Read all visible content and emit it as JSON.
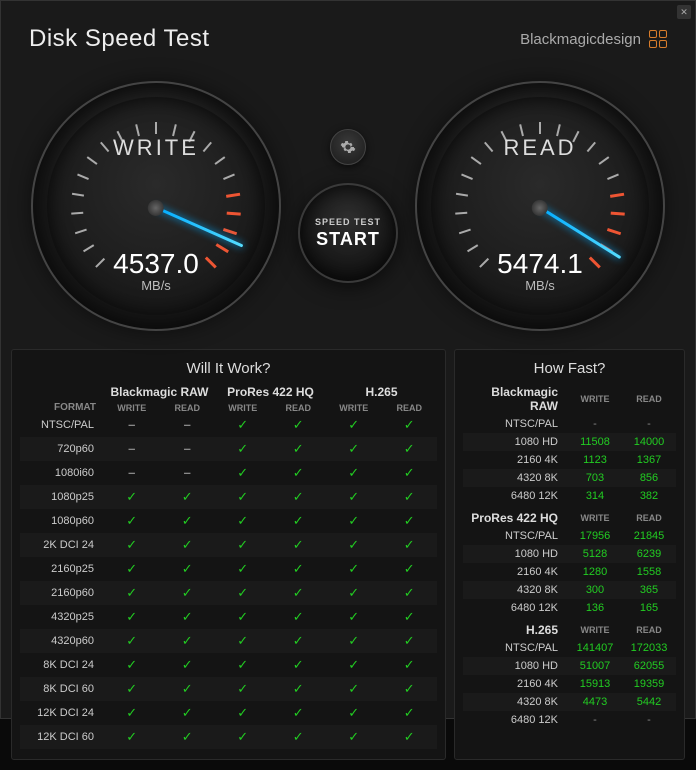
{
  "window": {
    "title": "Disk Speed Test",
    "brand": "Blackmagicdesign"
  },
  "gauges": {
    "write": {
      "label": "WRITE",
      "value": "4537.0",
      "unit": "MB/s",
      "angle": 24
    },
    "read": {
      "label": "READ",
      "value": "5474.1",
      "unit": "MB/s",
      "angle": 32
    }
  },
  "start": {
    "line1": "SPEED TEST",
    "line2": "START"
  },
  "willItWork": {
    "title": "Will It Work?",
    "formatLabel": "FORMAT",
    "codecs": [
      "Blackmagic RAW",
      "ProRes 422 HQ",
      "H.265"
    ],
    "subcols": [
      "WRITE",
      "READ"
    ],
    "rows": [
      {
        "fmt": "NTSC/PAL",
        "v": [
          "dash",
          "dash",
          "check",
          "check",
          "check",
          "check"
        ]
      },
      {
        "fmt": "720p60",
        "v": [
          "dash",
          "dash",
          "check",
          "check",
          "check",
          "check"
        ]
      },
      {
        "fmt": "1080i60",
        "v": [
          "dash",
          "dash",
          "check",
          "check",
          "check",
          "check"
        ]
      },
      {
        "fmt": "1080p25",
        "v": [
          "check",
          "check",
          "check",
          "check",
          "check",
          "check"
        ]
      },
      {
        "fmt": "1080p60",
        "v": [
          "check",
          "check",
          "check",
          "check",
          "check",
          "check"
        ]
      },
      {
        "fmt": "2K DCI 24",
        "v": [
          "check",
          "check",
          "check",
          "check",
          "check",
          "check"
        ]
      },
      {
        "fmt": "2160p25",
        "v": [
          "check",
          "check",
          "check",
          "check",
          "check",
          "check"
        ]
      },
      {
        "fmt": "2160p60",
        "v": [
          "check",
          "check",
          "check",
          "check",
          "check",
          "check"
        ]
      },
      {
        "fmt": "4320p25",
        "v": [
          "check",
          "check",
          "check",
          "check",
          "check",
          "check"
        ]
      },
      {
        "fmt": "4320p60",
        "v": [
          "check",
          "check",
          "check",
          "check",
          "check",
          "check"
        ]
      },
      {
        "fmt": "8K DCI 24",
        "v": [
          "check",
          "check",
          "check",
          "check",
          "check",
          "check"
        ]
      },
      {
        "fmt": "8K DCI 60",
        "v": [
          "check",
          "check",
          "check",
          "check",
          "check",
          "check"
        ]
      },
      {
        "fmt": "12K DCI 24",
        "v": [
          "check",
          "check",
          "check",
          "check",
          "check",
          "check"
        ]
      },
      {
        "fmt": "12K DCI 60",
        "v": [
          "check",
          "check",
          "check",
          "check",
          "check",
          "check"
        ]
      }
    ]
  },
  "howFast": {
    "title": "How Fast?",
    "subcols": [
      "WRITE",
      "READ"
    ],
    "sections": [
      {
        "codec": "Blackmagic RAW",
        "rows": [
          {
            "res": "NTSC/PAL",
            "w": "-",
            "r": "-"
          },
          {
            "res": "1080 HD",
            "w": "11508",
            "r": "14000"
          },
          {
            "res": "2160 4K",
            "w": "1123",
            "r": "1367"
          },
          {
            "res": "4320 8K",
            "w": "703",
            "r": "856"
          },
          {
            "res": "6480 12K",
            "w": "314",
            "r": "382"
          }
        ]
      },
      {
        "codec": "ProRes 422 HQ",
        "rows": [
          {
            "res": "NTSC/PAL",
            "w": "17956",
            "r": "21845"
          },
          {
            "res": "1080 HD",
            "w": "5128",
            "r": "6239"
          },
          {
            "res": "2160 4K",
            "w": "1280",
            "r": "1558"
          },
          {
            "res": "4320 8K",
            "w": "300",
            "r": "365"
          },
          {
            "res": "6480 12K",
            "w": "136",
            "r": "165"
          }
        ]
      },
      {
        "codec": "H.265",
        "rows": [
          {
            "res": "NTSC/PAL",
            "w": "141407",
            "r": "172033"
          },
          {
            "res": "1080 HD",
            "w": "51007",
            "r": "62055"
          },
          {
            "res": "2160 4K",
            "w": "15913",
            "r": "19359"
          },
          {
            "res": "4320 8K",
            "w": "4473",
            "r": "5442"
          },
          {
            "res": "6480 12K",
            "w": "-",
            "r": "-"
          }
        ]
      }
    ]
  }
}
